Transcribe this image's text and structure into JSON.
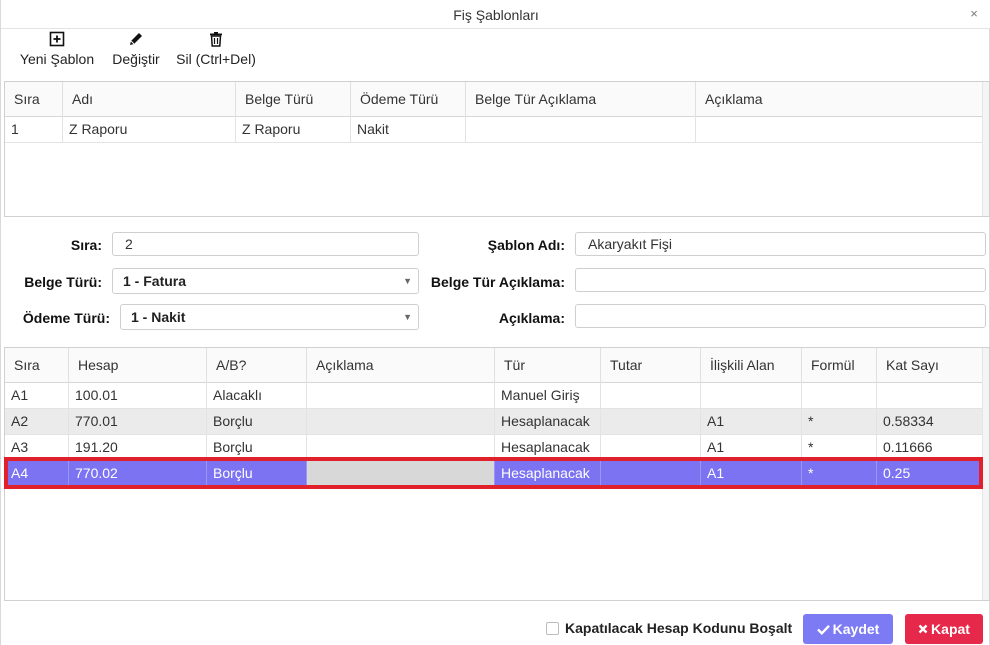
{
  "window": {
    "title": "Fiş Şablonları",
    "close_symbol": "×"
  },
  "toolbar": {
    "new_label": "Yeni Şablon",
    "edit_label": "Değiştir",
    "delete_label": "Sil (Ctrl+Del)"
  },
  "templates_grid": {
    "columns": [
      "Sıra",
      "Adı",
      "Belge Türü",
      "Ödeme Türü",
      "Belge Tür Açıklama",
      "Açıklama"
    ],
    "rows": [
      [
        "1",
        "Z Raporu",
        "Z Raporu",
        "Nakit",
        "",
        ""
      ]
    ]
  },
  "form": {
    "sira_label": "Sıra:",
    "sira_value": "2",
    "sablon_adi_label": "Şablon Adı:",
    "sablon_adi_value": "Akaryakıt Fişi",
    "belge_turu_label": "Belge Türü:",
    "belge_turu_value": "1 - Fatura",
    "belge_tur_aciklama_label": "Belge Tür Açıklama:",
    "belge_tur_aciklama_value": "",
    "odeme_turu_label": "Ödeme Türü:",
    "odeme_turu_value": "1 - Nakit",
    "aciklama_label": "Açıklama:",
    "aciklama_value": ""
  },
  "lines_grid": {
    "columns": [
      "Sıra",
      "Hesap",
      "A/B?",
      "Açıklama",
      "Tür",
      "Tutar",
      "İlişkili Alan",
      "Formül",
      "Kat Sayı"
    ],
    "rows": [
      [
        "A1",
        "100.01",
        "Alacaklı",
        "",
        "Manuel Giriş",
        "",
        "",
        "",
        ""
      ],
      [
        "A2",
        "770.01",
        "Borçlu",
        "",
        "Hesaplanacak",
        "",
        "A1",
        "*",
        "0.58334"
      ],
      [
        "A3",
        "191.20",
        "Borçlu",
        "",
        "Hesaplanacak",
        "",
        "A1",
        "*",
        "0.11666"
      ],
      [
        "A4",
        "770.02",
        "Borçlu",
        "",
        "Hesaplanacak",
        "",
        "A1",
        "*",
        "0.25"
      ]
    ],
    "selected_row": "A4"
  },
  "footer": {
    "checkbox_label": "Kapatılacak Hesap Kodunu Boşalt",
    "checkbox_checked": false,
    "save_label": "Kaydet",
    "close_label": "Kapat"
  },
  "colors": {
    "selected_row": "#7b73f2",
    "selection_outline": "#e0212b",
    "save_button": "#7d7bf4",
    "close_button": "#e6284a"
  },
  "icons": {
    "new": "plus-square-icon",
    "edit": "pencil-icon",
    "delete": "trash-icon",
    "save": "check-icon",
    "close": "x-icon"
  }
}
